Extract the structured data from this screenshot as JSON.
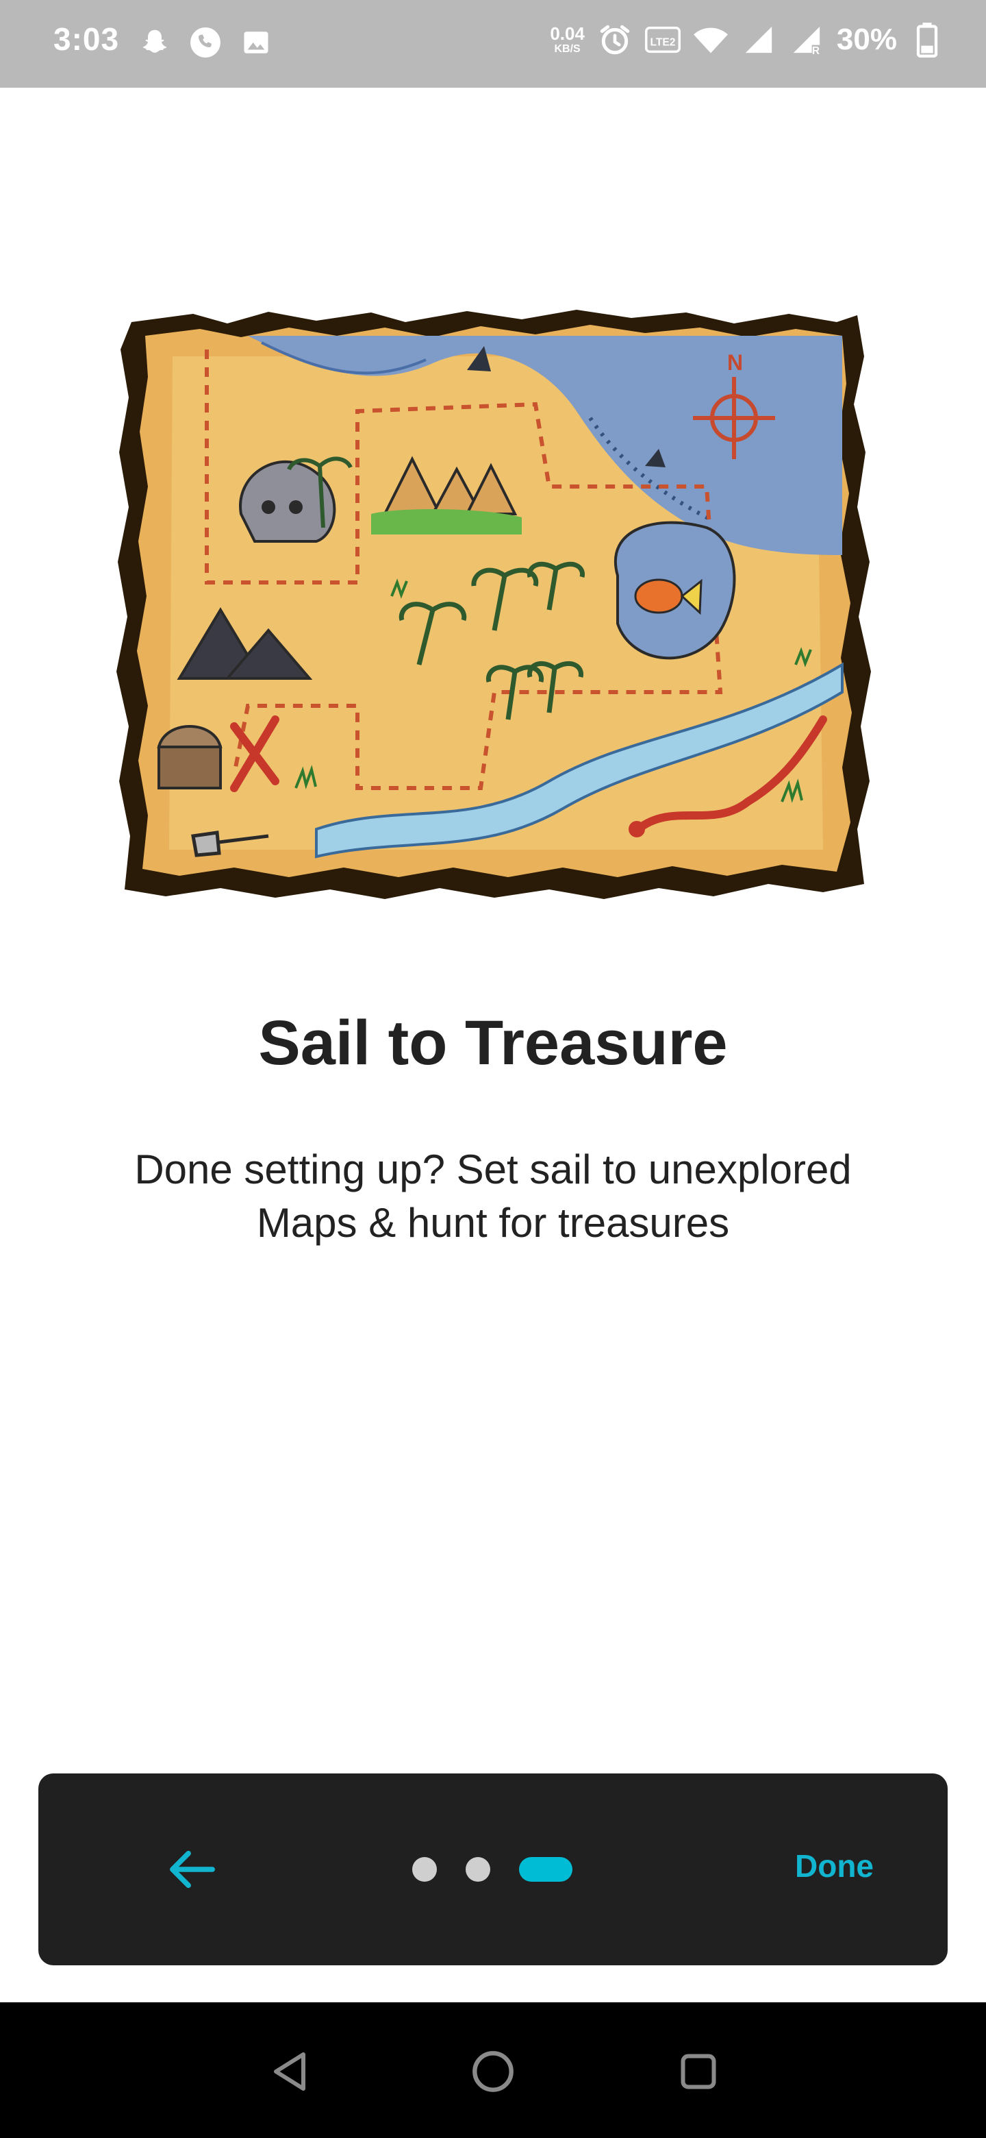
{
  "status_bar": {
    "time": "3:03",
    "notification_icons": [
      "snapchat-icon",
      "phone-call-icon",
      "image-icon"
    ],
    "net_speed_value": "0.04",
    "net_speed_unit": "KB/S",
    "volte_label": "LTE2",
    "battery_percent": "30%"
  },
  "onboarding": {
    "illustration": "treasure-map",
    "title": "Sail to Treasure",
    "description": "Done setting up? Set sail to unexplored Maps & hunt for treasures"
  },
  "nav_card": {
    "back_icon": "arrow-left-icon",
    "page_count": 3,
    "current_page": 3,
    "done_label": "Done",
    "accent_color": "#00bcd4",
    "card_color": "#202020"
  },
  "system_nav": {
    "buttons": [
      "back-triangle-icon",
      "home-circle-icon",
      "recents-square-icon"
    ]
  }
}
